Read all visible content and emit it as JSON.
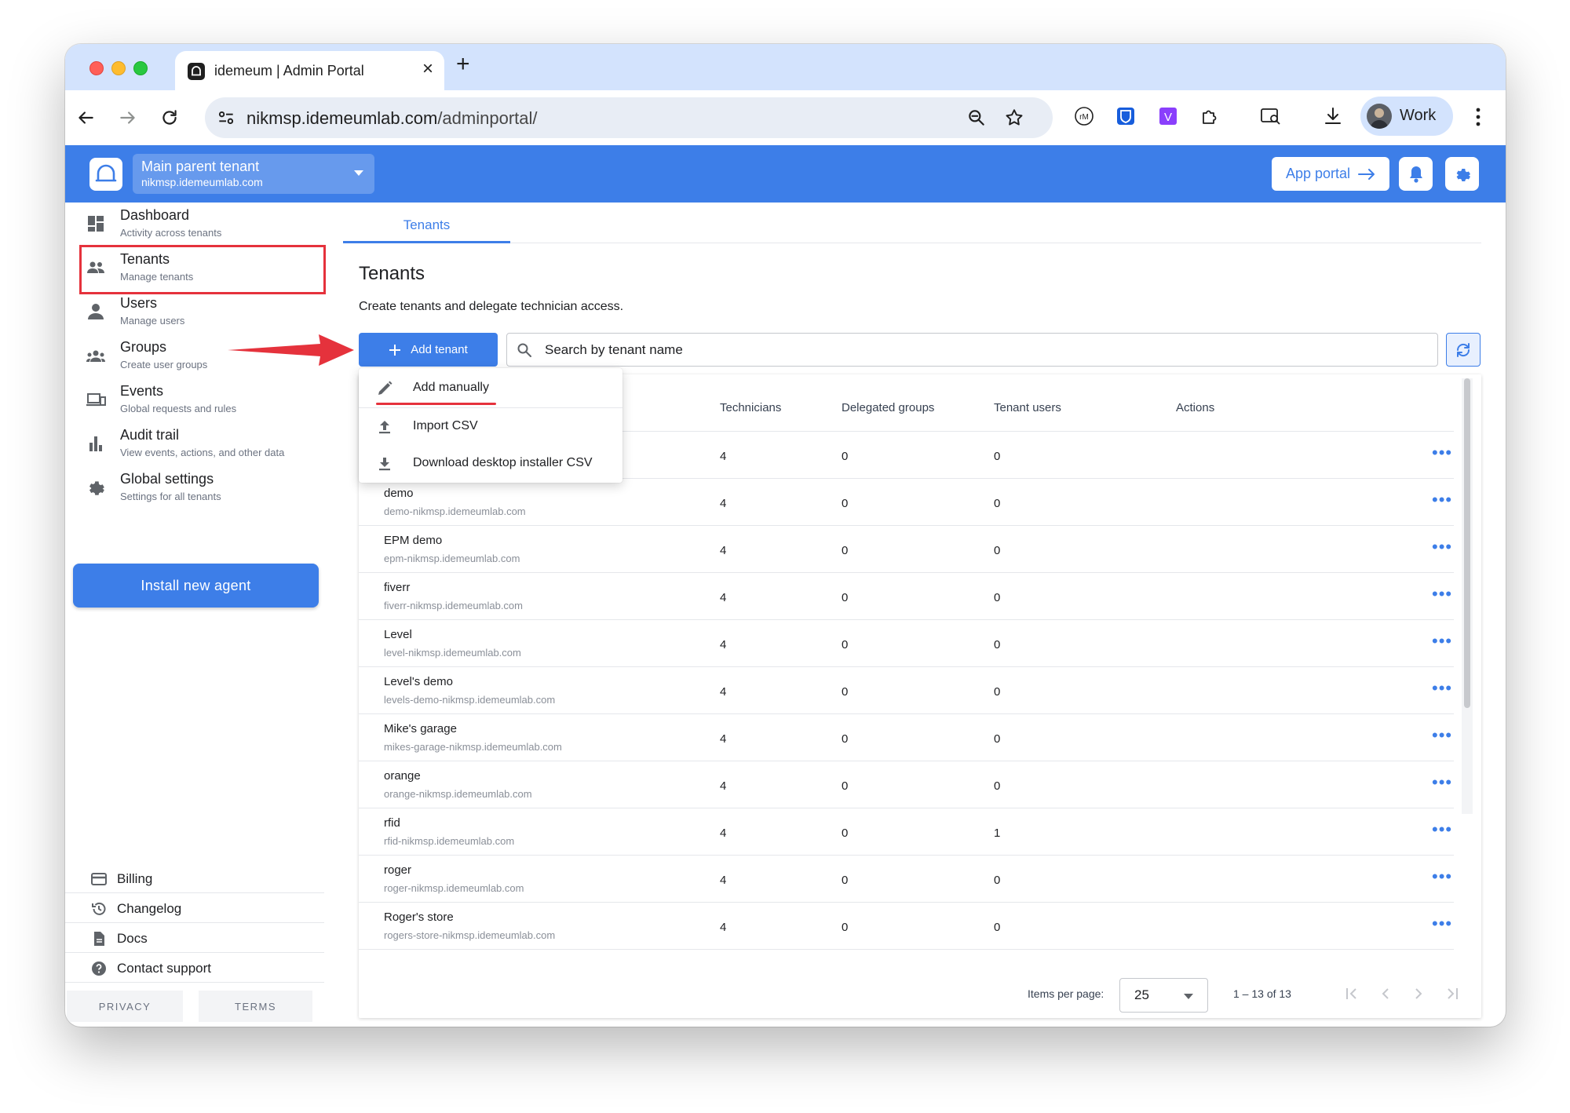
{
  "browser": {
    "tab_title": "idemeum | Admin Portal",
    "url_host": "nikmsp.idemeumlab.com",
    "url_path": "/adminportal/",
    "profile_label": "Work"
  },
  "header": {
    "tenant_name": "Main parent tenant",
    "tenant_host": "nikmsp.idemeumlab.com",
    "app_portal_label": "App portal"
  },
  "sidebar": {
    "items": [
      {
        "label": "Dashboard",
        "sub": "Activity across tenants",
        "icon": "dashboard-icon"
      },
      {
        "label": "Tenants",
        "sub": "Manage tenants",
        "icon": "people-icon"
      },
      {
        "label": "Users",
        "sub": "Manage users",
        "icon": "person-icon"
      },
      {
        "label": "Groups",
        "sub": "Create user groups",
        "icon": "groups-icon"
      },
      {
        "label": "Events",
        "sub": "Global requests and rules",
        "icon": "devices-icon"
      },
      {
        "label": "Audit trail",
        "sub": "View events, actions, and other data",
        "icon": "bar-chart-icon"
      },
      {
        "label": "Global settings",
        "sub": "Settings for all tenants",
        "icon": "gear-icon"
      }
    ],
    "install_label": "Install new agent",
    "bottom_links": [
      {
        "label": "Billing",
        "icon": "card-icon"
      },
      {
        "label": "Changelog",
        "icon": "history-icon"
      },
      {
        "label": "Docs",
        "icon": "document-icon"
      },
      {
        "label": "Contact support",
        "icon": "help-icon"
      }
    ],
    "privacy_label": "PRIVACY",
    "terms_label": "TERMS"
  },
  "main": {
    "tab_label": "Tenants",
    "title": "Tenants",
    "description": "Create tenants and delegate technician access.",
    "add_button_label": "Add tenant",
    "search_placeholder": "Search by tenant name",
    "menu": [
      {
        "label": "Add manually",
        "icon": "pencil-icon"
      },
      {
        "label": "Import CSV",
        "icon": "upload-icon"
      },
      {
        "label": "Download desktop installer CSV",
        "icon": "download-icon"
      }
    ],
    "columns": {
      "technicians": "Technicians",
      "delegated_groups": "Delegated groups",
      "tenant_users": "Tenant users",
      "actions": "Actions"
    },
    "rows": [
      {
        "name": "",
        "domain": "",
        "technicians": "4",
        "groups": "0",
        "users": "0"
      },
      {
        "name": "demo",
        "domain": "demo-nikmsp.idemeumlab.com",
        "technicians": "4",
        "groups": "0",
        "users": "0"
      },
      {
        "name": "EPM demo",
        "domain": "epm-nikmsp.idemeumlab.com",
        "technicians": "4",
        "groups": "0",
        "users": "0"
      },
      {
        "name": "fiverr",
        "domain": "fiverr-nikmsp.idemeumlab.com",
        "technicians": "4",
        "groups": "0",
        "users": "0"
      },
      {
        "name": "Level",
        "domain": "level-nikmsp.idemeumlab.com",
        "technicians": "4",
        "groups": "0",
        "users": "0"
      },
      {
        "name": "Level's demo",
        "domain": "levels-demo-nikmsp.idemeumlab.com",
        "technicians": "4",
        "groups": "0",
        "users": "0"
      },
      {
        "name": "Mike's garage",
        "domain": "mikes-garage-nikmsp.idemeumlab.com",
        "technicians": "4",
        "groups": "0",
        "users": "0"
      },
      {
        "name": "orange",
        "domain": "orange-nikmsp.idemeumlab.com",
        "technicians": "4",
        "groups": "0",
        "users": "0"
      },
      {
        "name": "rfid",
        "domain": "rfid-nikmsp.idemeumlab.com",
        "technicians": "4",
        "groups": "0",
        "users": "1"
      },
      {
        "name": "roger",
        "domain": "roger-nikmsp.idemeumlab.com",
        "technicians": "4",
        "groups": "0",
        "users": "0"
      },
      {
        "name": "Roger's store",
        "domain": "rogers-store-nikmsp.idemeumlab.com",
        "technicians": "4",
        "groups": "0",
        "users": "0"
      }
    ],
    "actions_glyph": "•••",
    "pager": {
      "items_per_page_label": "Items per page:",
      "items_per_page": "25",
      "range_label": "1 – 13 of 13"
    }
  },
  "colors": {
    "brand_blue": "#3d7ee8",
    "annotation_red": "#e5323c"
  }
}
